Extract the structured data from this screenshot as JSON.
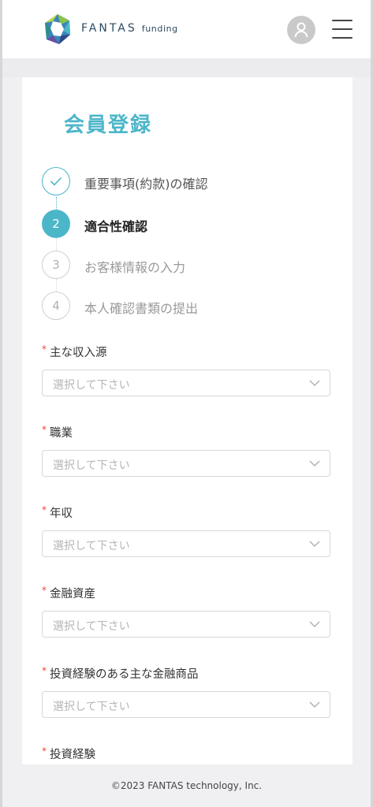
{
  "header": {
    "brand_main": "FANTAS",
    "brand_sub": "funding",
    "user_icon": "user-icon",
    "menu_icon": "hamburger-menu-icon"
  },
  "page": {
    "title": "会員登録"
  },
  "steps": [
    {
      "number": "",
      "label": "重要事項(約款)の確認",
      "status": "done"
    },
    {
      "number": "2",
      "label": "適合性確認",
      "status": "active"
    },
    {
      "number": "3",
      "label": "お客様情報の入力",
      "status": "todo"
    },
    {
      "number": "4",
      "label": "本人確認書類の提出",
      "status": "todo"
    }
  ],
  "form": {
    "required_mark": "*",
    "fields": [
      {
        "label": "主な収入源",
        "placeholder": "選択して下さい"
      },
      {
        "label": "職業",
        "placeholder": "選択して下さい"
      },
      {
        "label": "年収",
        "placeholder": "選択して下さい"
      },
      {
        "label": "金融資産",
        "placeholder": "選択して下さい"
      },
      {
        "label": "投資経験のある主な金融商品",
        "placeholder": "選択して下さい"
      },
      {
        "label": "投資経験"
      }
    ]
  },
  "footer": {
    "copyright": "©2023 FANTAS technology, Inc."
  },
  "colors": {
    "accent": "#4cb6c9",
    "required": "#e0473b",
    "background": "#f0f0f2"
  }
}
